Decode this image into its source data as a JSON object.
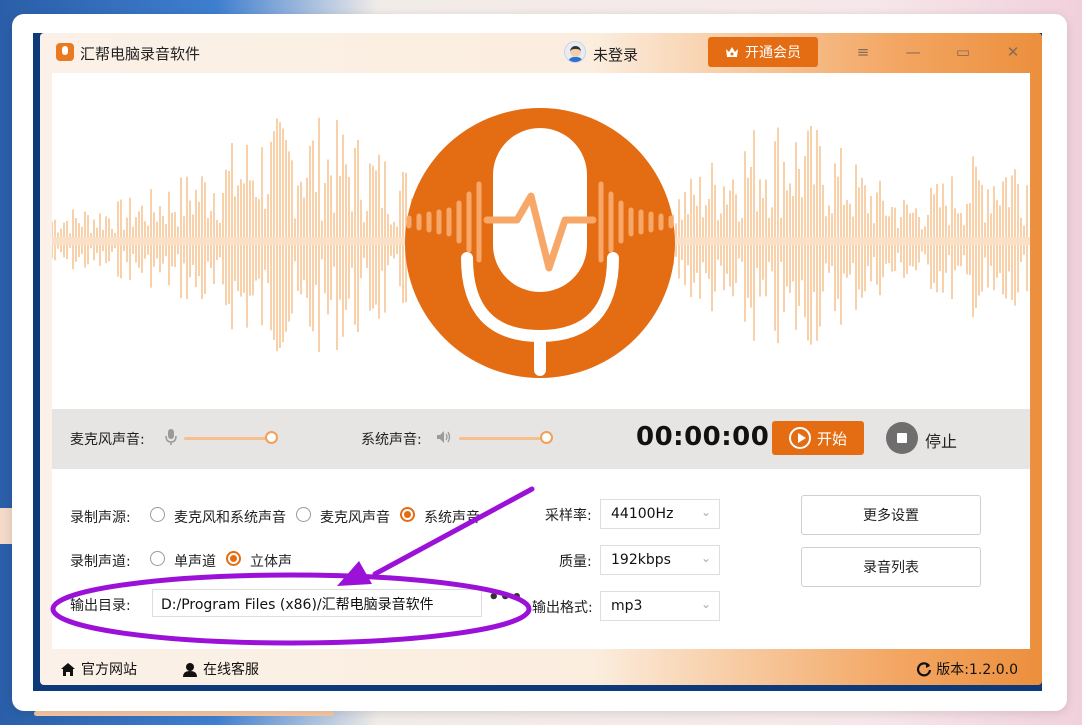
{
  "app": {
    "title": "汇帮电脑录音软件",
    "login_status": "未登录",
    "vip_button": "开通会员",
    "menu_icon": "≡",
    "minimize_icon": "—",
    "maximize_icon": "▭",
    "close_icon": "✕"
  },
  "controls": {
    "mic_volume_label": "麦克风声音:",
    "mic_volume_level": 0.95,
    "system_volume_label": "系统声音:",
    "system_volume_level": 0.95,
    "timer": "00:00:00",
    "start_label": "开始",
    "stop_label": "停止"
  },
  "settings": {
    "source_label": "录制声源:",
    "source_options": [
      "麦克风和系统声音",
      "麦克风声音",
      "系统声音"
    ],
    "source_selected": "系统声音",
    "channel_label": "录制声道:",
    "channel_options": [
      "单声道",
      "立体声"
    ],
    "channel_selected": "立体声",
    "output_dir_label": "输出目录:",
    "output_dir_value": "D:/Program Files (x86)/汇帮电脑录音软件",
    "browse_label": "•••",
    "sample_rate_label": "采样率:",
    "sample_rate_value": "44100Hz",
    "quality_label": "质量:",
    "quality_value": "192kbps",
    "format_label": "输出格式:",
    "format_value": "mp3",
    "more_settings": "更多设置",
    "record_list": "录音列表"
  },
  "footer": {
    "website": "官方网站",
    "support": "在线客服",
    "version": "版本:1.2.0.0"
  },
  "colors": {
    "accent": "#e46c12",
    "annotation": "#9b11d8"
  }
}
